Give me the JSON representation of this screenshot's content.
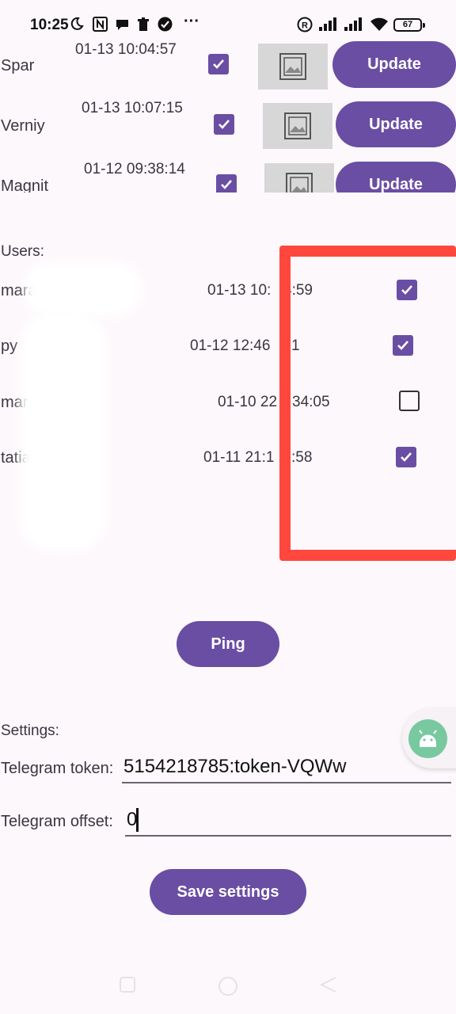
{
  "status_bar": {
    "time": "10:25",
    "notification_icons": [
      "moon-icon",
      "nfc-icon",
      "chat-bubble-icon",
      "trash-icon",
      "check-circle-icon",
      "more-dots-icon"
    ],
    "system_icons": [
      "registered-icon",
      "signal-1-icon",
      "signal-2-icon",
      "wifi-icon",
      "battery-icon"
    ],
    "battery": "67",
    "more": "···",
    "registered": "R"
  },
  "shops": [
    {
      "name": "Spar",
      "date": "01-13 10:04:57",
      "checked": true,
      "button": "Update"
    },
    {
      "name": "Verniy",
      "date": "01-13 10:07:15",
      "checked": true,
      "button": "Update"
    },
    {
      "name": "Magnit",
      "date": "01-12 09:38:14",
      "checked": true,
      "button": "Update"
    }
  ],
  "users_section": {
    "label": "Users:",
    "users": [
      {
        "name": "mara",
        "date": "01-13 10:",
        "date_tail": "4:59",
        "checked": true
      },
      {
        "name": "py",
        "date": "01-12 12:46",
        "date_tail": "1",
        "checked": true
      },
      {
        "name": "mar",
        "date": "01-10 22",
        "date_tail": "34:05",
        "checked": false
      },
      {
        "name": "tatiar",
        "date": "01-11 21:1",
        "date_tail": ":58",
        "checked": true
      }
    ]
  },
  "ping_button": "Ping",
  "settings": {
    "label": "Settings:",
    "token_label": "Telegram token:",
    "token_value": "5154218785:token-VQWw",
    "offset_label": "Telegram offset:",
    "offset_value": "0",
    "save_button": "Save settings"
  },
  "colors": {
    "accent": "#6a4ea3",
    "background": "#fdf8fc",
    "highlight": "#ff473d"
  }
}
